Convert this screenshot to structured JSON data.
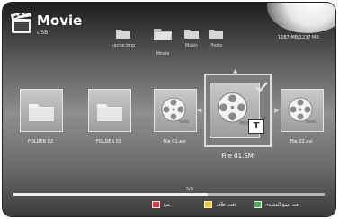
{
  "header": {
    "title": "Movie",
    "source": "USB"
  },
  "storage": "1287 MB/1237 MB",
  "breadcrumb": [
    {
      "label": "cache.tmp",
      "icon": "folder-icon"
    },
    {
      "label": "Movie",
      "icon": "folder-open-icon"
    },
    {
      "label": "Music",
      "icon": "folder-icon"
    },
    {
      "label": "Photo",
      "icon": "folder-icon"
    }
  ],
  "tiles": [
    {
      "label": "FOLDER 02",
      "icon": "folder-icon"
    },
    {
      "label": "FOLDER 03",
      "icon": "folder-icon"
    },
    {
      "label": "File 01.avi",
      "icon": "film-reel-icon"
    },
    {
      "label": "File 01.SMI",
      "icon": "film-reel-icon",
      "badge": "T",
      "selected": true
    },
    {
      "label": "File 02.avi",
      "icon": "film-reel-icon"
    }
  ],
  "pagination": {
    "text": "5/8",
    "progress": 0.625
  },
  "legend": [
    {
      "color": "#4caf50",
      "label": "تغيير منبع المحتوى"
    },
    {
      "color": "#f5c518",
      "label": "تغيير ظاهر"
    },
    {
      "color": "#e53935",
      "label": "منع"
    }
  ]
}
